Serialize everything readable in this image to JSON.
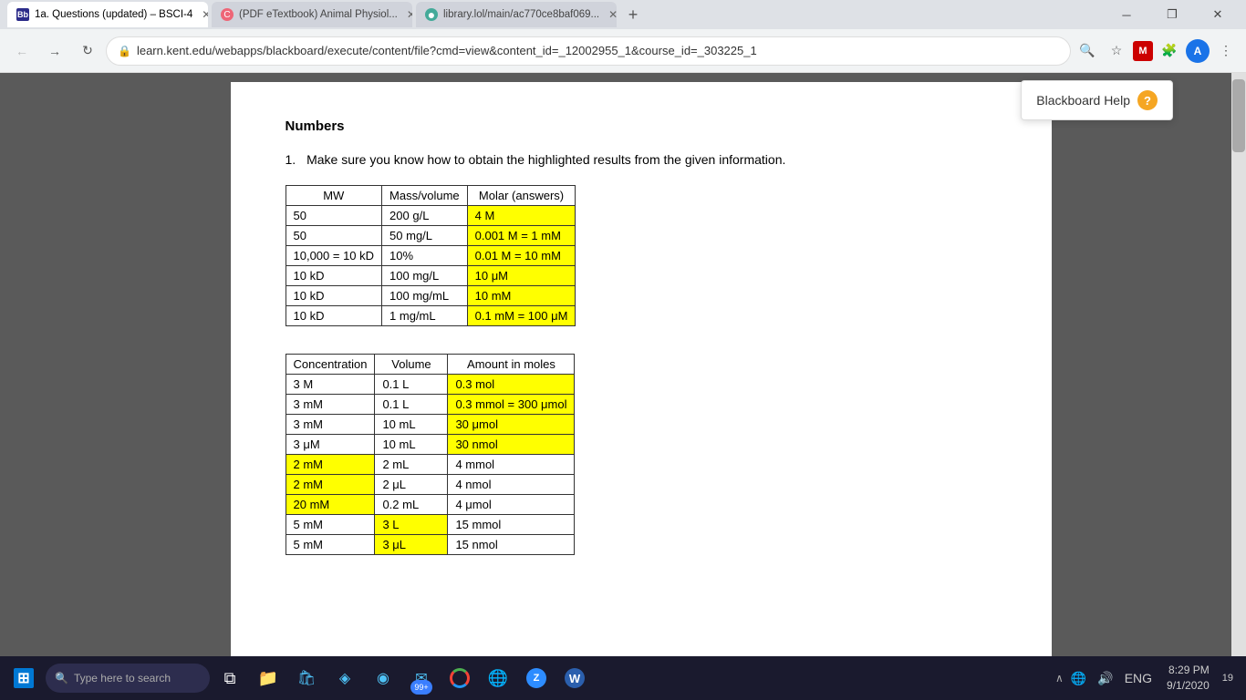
{
  "browser": {
    "tabs": [
      {
        "id": "tab1",
        "favicon_type": "bb",
        "favicon_label": "Bb",
        "label": "1a. Questions (updated) – BSCI-4",
        "active": true
      },
      {
        "id": "tab2",
        "favicon_type": "cc",
        "favicon_label": "C",
        "label": "(PDF eTextbook) Animal Physiol...",
        "active": false
      },
      {
        "id": "tab3",
        "favicon_type": "lib",
        "favicon_label": "●",
        "label": "library.lol/main/ac770ce8baf069...",
        "active": false
      }
    ],
    "url": "learn.kent.edu/webapps/blackboard/execute/content/file?cmd=view&content_id=_12002955_1&course_id=_303225_1",
    "window_controls": [
      "–",
      "❐",
      "✕"
    ]
  },
  "help_popup": {
    "label": "Blackboard Help",
    "icon": "?"
  },
  "document": {
    "section_title": "Numbers",
    "instruction": "Make sure you know how to obtain the highlighted results from the given information.",
    "table1": {
      "headers": [
        "MW",
        "Mass/volume",
        "Molar (answers)"
      ],
      "rows": [
        {
          "mw": "50",
          "mass_volume": "200 g/L",
          "molar": "4 M",
          "highlight_molar": true
        },
        {
          "mw": "50",
          "mass_volume": "50 mg/L",
          "molar": "0.001 M = 1 mM",
          "highlight_molar": true
        },
        {
          "mw": "10,000 = 10 kD",
          "mass_volume": "10%",
          "molar": "0.01 M = 10 mM",
          "highlight_molar": true
        },
        {
          "mw": "10 kD",
          "mass_volume": "100 mg/L",
          "molar": "10 μM",
          "highlight_molar": true
        },
        {
          "mw": "10 kD",
          "mass_volume": "100 mg/mL",
          "molar": "10 mM",
          "highlight_molar": true
        },
        {
          "mw": "10 kD",
          "mass_volume": "1 mg/mL",
          "molar": "0.1 mM = 100 μM",
          "highlight_molar": true
        }
      ]
    },
    "table2": {
      "headers": [
        "Concentration",
        "Volume",
        "Amount in moles"
      ],
      "rows": [
        {
          "conc": "3 M",
          "volume": "0.1 L",
          "amount": "0.3 mol",
          "highlight_conc": false,
          "highlight_vol": false,
          "highlight_amount": true
        },
        {
          "conc": "3 mM",
          "volume": "0.1 L",
          "amount": "0.3 mmol = 300 μmol",
          "highlight_conc": false,
          "highlight_vol": false,
          "highlight_amount": true
        },
        {
          "conc": "3 mM",
          "volume": "10 mL",
          "amount": "30 μmol",
          "highlight_conc": false,
          "highlight_vol": false,
          "highlight_amount": true
        },
        {
          "conc": "3 μM",
          "volume": "10 mL",
          "amount": "30 nmol",
          "highlight_conc": false,
          "highlight_vol": false,
          "highlight_amount": true
        },
        {
          "conc": "2 mM",
          "volume": "2 mL",
          "amount": "4 mmol",
          "highlight_conc": true,
          "highlight_vol": false,
          "highlight_amount": false
        },
        {
          "conc": "2 mM",
          "volume": "2 μL",
          "amount": "4 nmol",
          "highlight_conc": true,
          "highlight_vol": false,
          "highlight_amount": false
        },
        {
          "conc": "20 mM",
          "volume": "0.2 mL",
          "amount": "4 μmol",
          "highlight_conc": true,
          "highlight_vol": false,
          "highlight_amount": false
        },
        {
          "conc": "5 mM",
          "volume": "3 L",
          "amount": "15 mmol",
          "highlight_conc": false,
          "highlight_vol": true,
          "highlight_amount": false
        },
        {
          "conc": "5 mM",
          "volume": "3 μL",
          "amount": "15 nmol",
          "highlight_conc": false,
          "highlight_vol": true,
          "highlight_amount": false
        }
      ]
    }
  },
  "taskbar": {
    "search_placeholder": "Type here to search",
    "time": "8:29 PM",
    "date": "9/1/2020",
    "lang": "ENG",
    "notification_count": "19"
  }
}
